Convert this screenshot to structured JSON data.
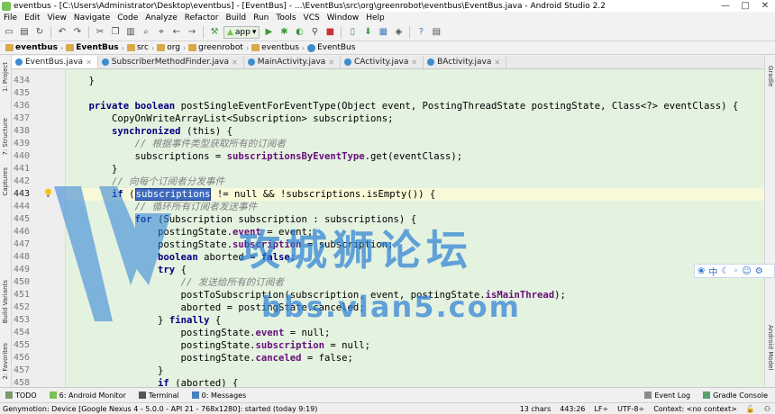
{
  "window": {
    "title": "eventbus - [C:\\Users\\Administrator\\Desktop\\eventbus] - [EventBus] - ...\\EventBus\\src\\org\\greenrobot\\eventbus\\EventBus.java - Android Studio 2.2",
    "minimize": "—",
    "maximize": "□",
    "close": "✕"
  },
  "menu": [
    "File",
    "Edit",
    "View",
    "Navigate",
    "Code",
    "Analyze",
    "Refactor",
    "Build",
    "Run",
    "Tools",
    "VCS",
    "Window",
    "Help"
  ],
  "toolbar": {
    "app_selector": "app"
  },
  "breadcrumbs": [
    "eventbus",
    "EventBus",
    "src",
    "org",
    "greenrobot",
    "eventbus",
    "EventBus"
  ],
  "side_tools": {
    "left": [
      "1: Project",
      "7: Structure",
      "Captures",
      "Build Variants",
      "2: Favorites"
    ],
    "right": [
      "Gradle",
      "Android Model"
    ]
  },
  "tabs": [
    {
      "label": "EventBus.java",
      "active": true
    },
    {
      "label": "SubscriberMethodFinder.java",
      "active": false
    },
    {
      "label": "MainActivity.java",
      "active": false
    },
    {
      "label": "CActivity.java",
      "active": false
    },
    {
      "label": "BActivity.java",
      "active": false
    }
  ],
  "editor": {
    "line_numbers": [
      "434",
      "435",
      "436",
      "437",
      "438",
      "439",
      "440",
      "441",
      "442",
      "443",
      "444",
      "445",
      "446",
      "447",
      "448",
      "449",
      "450",
      "451",
      "452",
      "453",
      "454",
      "455",
      "456",
      "457",
      "458"
    ],
    "current_line": "443",
    "code": {
      "l434": "    }",
      "l435": "",
      "l436a": "    ",
      "l436k": "private boolean ",
      "l436b": "postSingleEventForEventType(Object event, PostingThreadState postingState, Class<?> eventClass) {",
      "l437": "        CopyOnWriteArrayList<Subscription> subscriptions;",
      "l438k": "        synchronized ",
      "l438b": "(this) {",
      "l439": "            // 根据事件类型获取所有的订阅者",
      "l440a": "            subscriptions = ",
      "l440f": "subscriptionsByEventType",
      "l440b": ".get(eventClass);",
      "l441": "        }",
      "l442": "        // 向每个订阅者分发事件",
      "l443k": "        if ",
      "l443p": "(",
      "l443s": "subscriptions",
      "l443b": " != null && !subscriptions.isEmpty()) {",
      "l444": "            // 循环所有订阅者发送事件",
      "l445k": "            for ",
      "l445b": "(Subscription subscription : subscriptions) {",
      "l446a": "                postingState.",
      "l446f": "event",
      "l446b": " = event;",
      "l447a": "                postingState.",
      "l447f": "subscription",
      "l447b": " = subscription;",
      "l448k": "                boolean ",
      "l448b": "aborted = ",
      "l448f": "false",
      "l448c": ";",
      "l449k": "                try ",
      "l449b": "{",
      "l450": "                    // 发送给所有的订阅者",
      "l451a": "                    postToSubscription(subscription, event, postingState.",
      "l451f": "isMainThread",
      "l451b": ");",
      "l452": "                    aborted = postingState.canceled;",
      "l453a": "                } ",
      "l453k": "finally ",
      "l453b": "{",
      "l454a": "                    postingState.",
      "l454f": "event",
      "l454b": " = null;",
      "l455a": "                    postingState.",
      "l455f": "subscription",
      "l455b": " = null;",
      "l456a": "                    postingState.",
      "l456f": "canceled",
      "l456b": " = false;",
      "l457": "                }",
      "l458k": "                if ",
      "l458b": "(aborted) {"
    }
  },
  "watermark": {
    "title": "攻城狮论坛",
    "url": "bbs.vlan5.com"
  },
  "ime_bar": {
    "lang": "中"
  },
  "bottom_tools": [
    "TODO",
    "6: Android Monitor",
    "Terminal",
    "0: Messages",
    "Event Log",
    "Gradle Console"
  ],
  "status": {
    "message": "Genymotion: Device [Google Nexus 4 - 5.0.0 - API 21 - 768x1280]: started (today 9:19)",
    "chars": "13 chars",
    "position": "443:26",
    "line_sep": "LF÷",
    "encoding": "UTF-8÷",
    "context": "Context: <no context>"
  },
  "colors": {
    "code_bg": "#e4f2e0",
    "keyword": "#000080",
    "field": "#660e7a",
    "comment": "#808080",
    "selection": "#3d6abf"
  }
}
